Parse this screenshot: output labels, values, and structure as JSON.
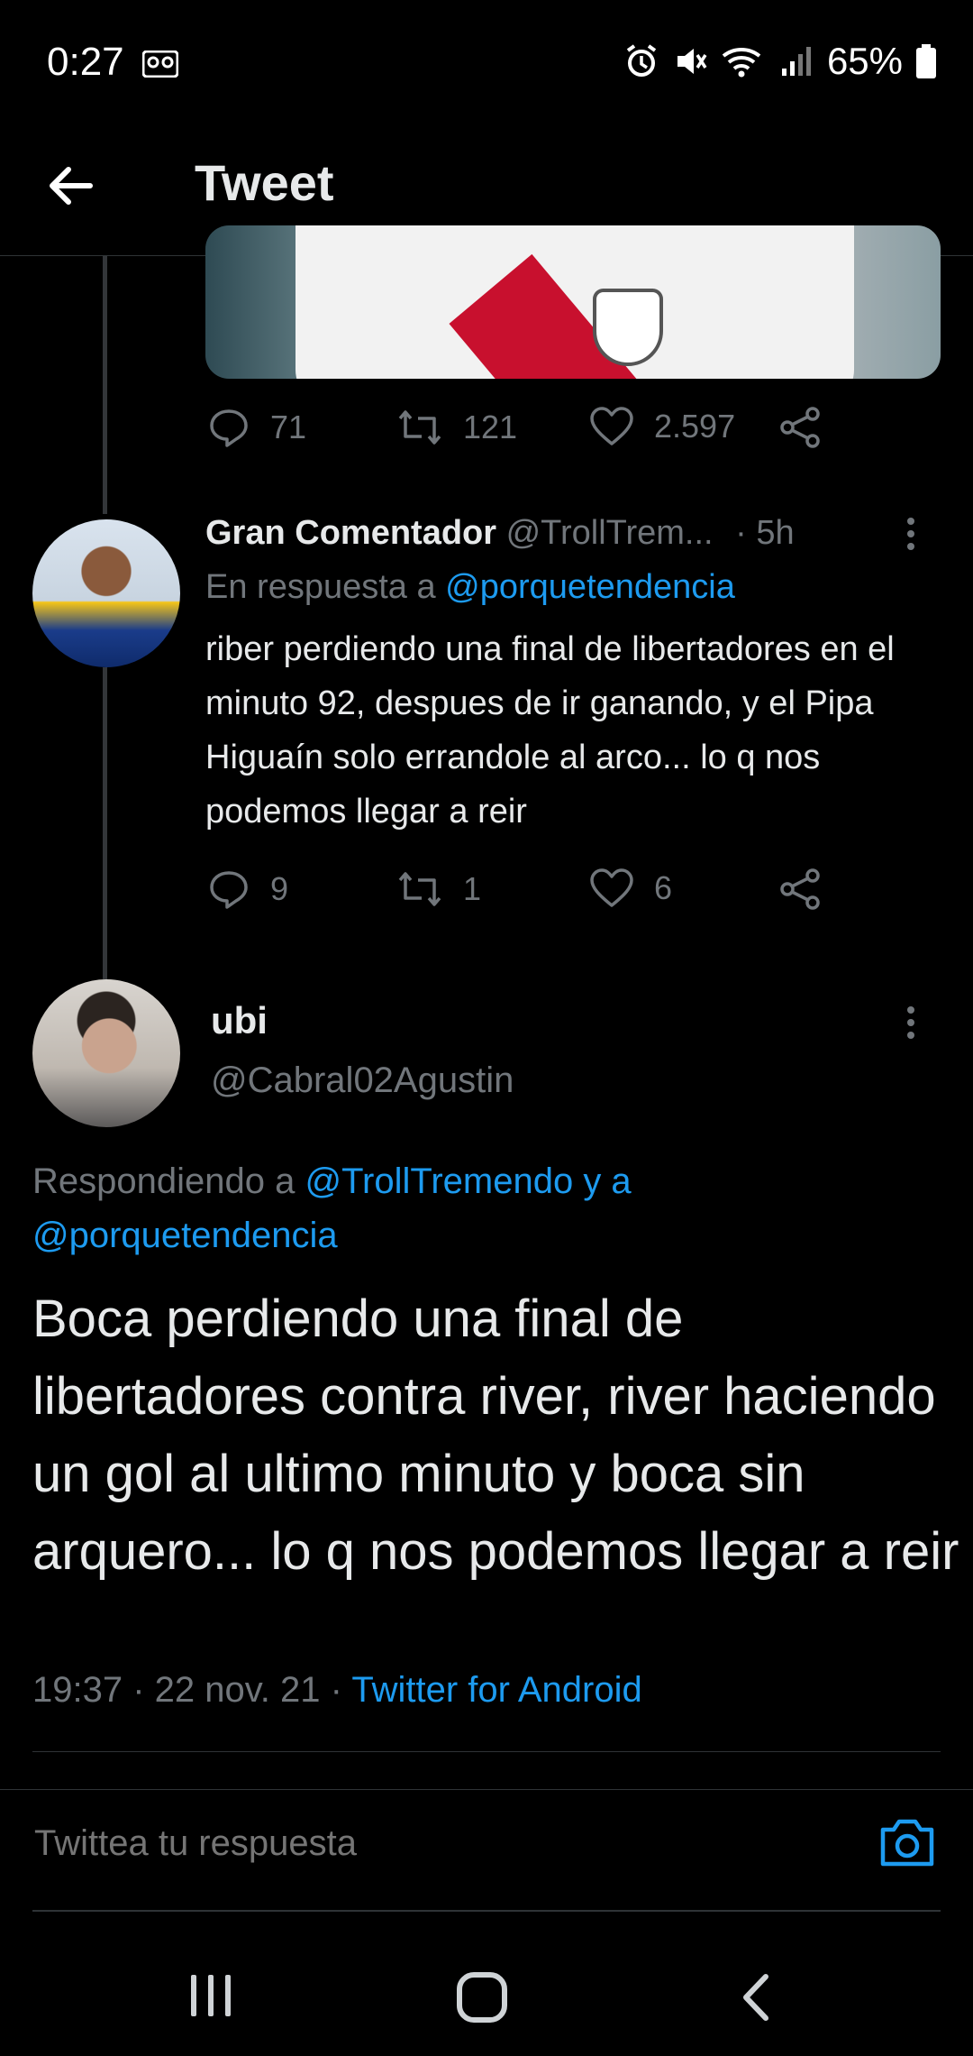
{
  "status_bar": {
    "time": "0:27",
    "battery": "65%"
  },
  "header": {
    "title": "Tweet"
  },
  "media_tweet": {
    "replies": "71",
    "retweets": "121",
    "likes": "2.597"
  },
  "reply_tweet": {
    "name": "Gran Comentador",
    "handle": "@TrollTrem...",
    "time": "· 5h",
    "replying_prefix": "En respuesta a",
    "replying_to": "@porquetendencia",
    "text": "riber perdiendo una final de libertadores en el minuto 92, despues de ir ganando, y el Pipa Higuaín solo errandole al arco... lo q nos podemos llegar a reir",
    "replies": "9",
    "retweets": "1",
    "likes": "6"
  },
  "main_tweet": {
    "name": "ubi",
    "handle": "@Cabral02Agustin",
    "replying_prefix": "Respondiendo a",
    "replying_to_1": "@TrollTremendo y a",
    "replying_to_2": "@porquetendencia",
    "text": "Boca perdiendo una final de libertadores contra river, river haciendo un gol al ultimo minuto y boca sin arquero... lo q nos podemos llegar a reir",
    "time": "19:37",
    "date": "· 22 nov. 21 ·",
    "source": "Twitter for Android"
  },
  "composer": {
    "placeholder": "Twittea tu respuesta"
  },
  "colors": {
    "background": "#000000",
    "text": "#e7e9ea",
    "secondary": "#71767b",
    "accent": "#1d9bf0"
  }
}
